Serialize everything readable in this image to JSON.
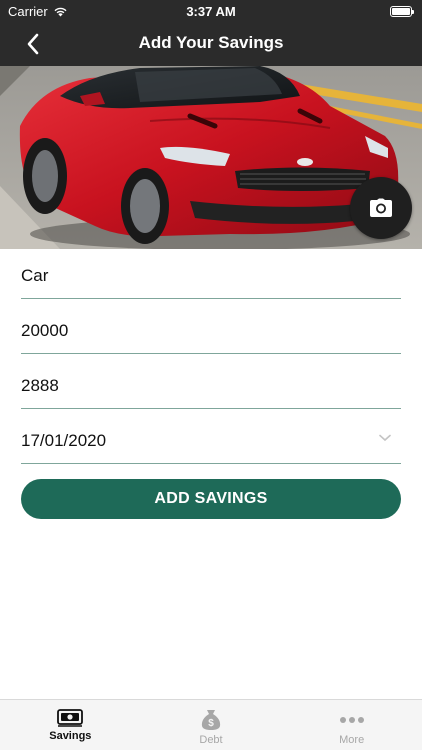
{
  "status_bar": {
    "carrier": "Carrier",
    "time": "3:37 AM",
    "icons": [
      "wifi-icon",
      "battery-icon"
    ]
  },
  "nav": {
    "title": "Add Your Savings",
    "back_icon": "chevron-left-icon"
  },
  "hero": {
    "image": "red-car-photo",
    "camera_icon": "camera-icon"
  },
  "form": {
    "name_value": "Car",
    "target_value": "20000",
    "amount_value": "2888",
    "date_value": "17/01/2020",
    "date_icon": "chevron-down-icon",
    "submit_label": "ADD SAVINGS"
  },
  "tabs": [
    {
      "label": "Savings",
      "icon": "money-icon",
      "active": true
    },
    {
      "label": "Debt",
      "icon": "money-bag-icon",
      "active": false
    },
    {
      "label": "More",
      "icon": "more-icon",
      "active": false
    }
  ],
  "colors": {
    "bar_background": "#2b2b2b",
    "accent": "#1e6a58",
    "field_underline": "#7fa69b",
    "car_red": "#d1202c"
  }
}
